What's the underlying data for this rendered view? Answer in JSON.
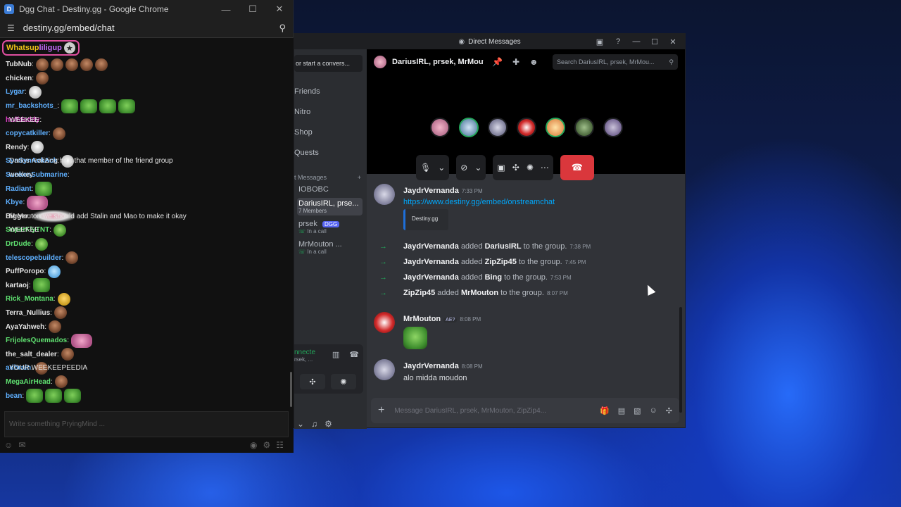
{
  "chrome": {
    "window_title": "Dgg Chat - Destiny.gg - Google Chrome",
    "url": "destiny.gg/embed/chat",
    "minimize": "—",
    "maximize": "☐",
    "close": "✕"
  },
  "dgg": {
    "pinned_part1": "Whatsup",
    "pinned_part2": "liligup",
    "input_placeholder": "Write something PryingMind ...",
    "lines": [
      {
        "user": "TubNub",
        "color": "#e4e4e4",
        "msg": "",
        "emotes": [
          "face",
          "face",
          "face",
          "face",
          "face"
        ]
      },
      {
        "user": "chicken",
        "color": "#e4e4e4",
        "msg": "",
        "emotes": [
          "face"
        ]
      },
      {
        "user": "Lygar",
        "color": "#5fb0ff",
        "msg": "",
        "emotes": [
          "white"
        ]
      },
      {
        "user": "mr_backshots_",
        "color": "#5fb0ff",
        "msg": "",
        "emotes": [
          "pepe",
          "pepe",
          "pepe",
          "pepe"
        ]
      },
      {
        "user": "huffdaddy",
        "color": "#e040c8",
        "msg": "WEEKEE",
        "emotes": []
      },
      {
        "user": "copycatkiller",
        "color": "#5fb0ff",
        "msg": "",
        "emotes": [
          "face"
        ]
      },
      {
        "user": "Rendy",
        "color": "#e4e4e4",
        "msg": "",
        "emotes": [
          "white"
        ]
      },
      {
        "user": "SynSynAckAck",
        "color": "#5fb0ff",
        "msg": "Darius realizing he's that member of the friend group",
        "emotes": [
          "white"
        ]
      },
      {
        "user": "SunkenSubmarine",
        "color": "#5fb0ff",
        "msg": "weekey",
        "emotes": []
      },
      {
        "user": "Radiant",
        "color": "#5fb0ff",
        "msg": "",
        "emotes": [
          "pepe"
        ]
      },
      {
        "user": "Kbye",
        "color": "#5fb0ff",
        "msg": "",
        "emotes": [
          "pink"
        ]
      },
      {
        "user": "Bigger",
        "color": "#e4e4e4",
        "msg": "MrMouton we should add Stalin and Mao to make it okay",
        "emotes": [
          "wings"
        ]
      },
      {
        "user": "SuperFlyTNT",
        "color": "#5fe070",
        "msg": "WEEKEE",
        "emotes": [
          "greenstar"
        ]
      },
      {
        "user": "DrDude",
        "color": "#5fe070",
        "msg": "",
        "emotes": [
          "greenstar"
        ]
      },
      {
        "user": "telescopebuilder",
        "color": "#5fb0ff",
        "msg": "",
        "emotes": [
          "face"
        ]
      },
      {
        "user": "PuffPoropo",
        "color": "#e4e4e4",
        "msg": "",
        "emotes": [
          "blue"
        ]
      },
      {
        "user": "kartaoj",
        "color": "#e4e4e4",
        "msg": "",
        "emotes": [
          "pepe"
        ]
      },
      {
        "user": "Rick_Montana",
        "color": "#5fe070",
        "msg": "",
        "emotes": [
          "gold"
        ]
      },
      {
        "user": "Terra_Nullius",
        "color": "#e4e4e4",
        "msg": "",
        "emotes": [
          "face"
        ]
      },
      {
        "user": "AyaYahweh",
        "color": "#e4e4e4",
        "msg": "",
        "emotes": [
          "face"
        ]
      },
      {
        "user": "FrijolesQuemados",
        "color": "#5fe070",
        "msg": "",
        "emotes": [
          "pink"
        ]
      },
      {
        "user": "the_salt_dealer",
        "color": "#e4e4e4",
        "msg": "",
        "emotes": [
          "face"
        ]
      },
      {
        "user": "adbrain",
        "color": "#5fb0ff",
        "msg": "YOUR WEEKEEPEEDIA",
        "emotes": [
          "face"
        ]
      },
      {
        "user": "MegaAirHead",
        "color": "#5fe070",
        "msg": "",
        "emotes": [
          "face"
        ]
      },
      {
        "user": "bean",
        "color": "#5fb0ff",
        "msg": "",
        "emotes": [
          "pepe",
          "pepe",
          "pepe"
        ]
      }
    ]
  },
  "discord": {
    "window_title": "Direct Messages",
    "search_btn": "or start a convers...",
    "nav": [
      "Friends",
      "Nitro",
      "Shop",
      "Quests"
    ],
    "dm_header": "t Messages",
    "dm_add": "+",
    "dms": [
      {
        "name": "IOBOBC",
        "sub": "",
        "badge": "",
        "active": false
      },
      {
        "name": "DariusIRL, prse...",
        "sub": "7 Members",
        "badge": "",
        "active": true
      },
      {
        "name": "prsek",
        "sub": "In a call",
        "badge": "DGG",
        "active": false
      },
      {
        "name": "MrMouton ...",
        "sub": "In a call",
        "badge": "",
        "active": false
      }
    ],
    "voice": {
      "title": "nnecte",
      "sub": "rsek, ..."
    },
    "group_name": "DariusIRL, prsek, MrMouton",
    "search_placeholder": "Search DariusIRL, prsek, MrMou...",
    "messages": {
      "m1": {
        "author": "JaydrVernanda",
        "time": "7:33 PM",
        "link": "https://www.destiny.gg/embed/onstreamchat",
        "embed": "Destiny.gg"
      },
      "sys": [
        {
          "actor": "JaydrVernanda",
          "verb": "added",
          "target": "DariusIRL",
          "suffix": "to the group.",
          "time": "7:38 PM"
        },
        {
          "actor": "JaydrVernanda",
          "verb": "added",
          "target": "ZipZip45",
          "suffix": "to the group.",
          "time": "7:45 PM"
        },
        {
          "actor": "JaydrVernanda",
          "verb": "added",
          "target": "Bing",
          "suffix": "to the group.",
          "time": "7:53 PM"
        },
        {
          "actor": "ZipZip45",
          "verb": "added",
          "target": "MrMouton",
          "suffix": "to the group.",
          "time": "8:07 PM"
        }
      ],
      "m2": {
        "author": "MrMouton",
        "badge": "AE?",
        "time": "8:08 PM"
      },
      "m3": {
        "author": "JaydrVernanda",
        "time": "8:08 PM",
        "text": "alo midda moudon"
      }
    },
    "composer_placeholder": "Message DariusIRL, prsek, MrMouton, ZipZip4...",
    "colors": {
      "accent": "#5865f2",
      "hangup": "#da373c",
      "online": "#23a55a",
      "link": "#00a8fc"
    }
  }
}
